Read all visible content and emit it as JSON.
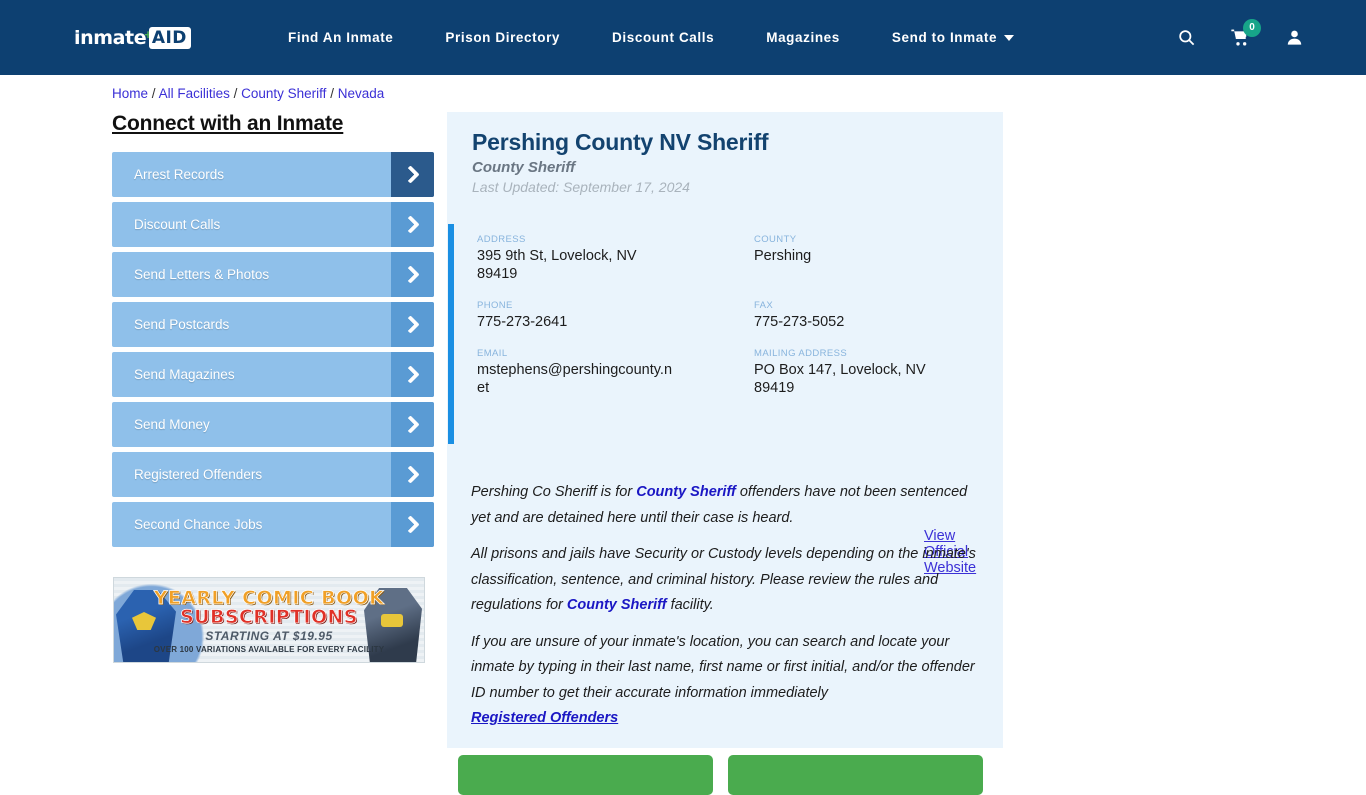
{
  "header": {
    "logo": {
      "part1": "inmate",
      "plus": "+",
      "part2": "AID"
    },
    "nav": [
      {
        "label": "Find An Inmate",
        "has_caret": false
      },
      {
        "label": "Prison Directory",
        "has_caret": false
      },
      {
        "label": "Discount Calls",
        "has_caret": false
      },
      {
        "label": "Magazines",
        "has_caret": false
      },
      {
        "label": "Send to Inmate",
        "has_caret": true
      }
    ],
    "icons": {
      "search": "search-icon",
      "cart": "cart-icon",
      "cart_count": "0",
      "account": "user-icon"
    },
    "background_color": "#0d4071",
    "badge_color": "#17a589"
  },
  "breadcrumb": {
    "items": [
      "Home",
      "All Facilities",
      "County Sheriff",
      "Nevada"
    ],
    "separator": "/",
    "link_color": "#3b30d6"
  },
  "sidebar": {
    "title": "Connect with an Inmate",
    "items": [
      {
        "label": "Arrest Records",
        "active": true
      },
      {
        "label": "Discount Calls",
        "active": false
      },
      {
        "label": "Send Letters & Photos",
        "active": false
      },
      {
        "label": "Send Postcards",
        "active": false
      },
      {
        "label": "Send Magazines",
        "active": false
      },
      {
        "label": "Send Money",
        "active": false
      },
      {
        "label": "Registered Offenders",
        "active": false
      },
      {
        "label": "Second Chance Jobs",
        "active": false
      }
    ],
    "button_color": "#8fc0ea",
    "chevron_color": "#5a9bd4",
    "chevron_active_color": "#2b5a8c"
  },
  "ad": {
    "line1": "YEARLY COMIC BOOK",
    "line2": "SUBSCRIPTIONS",
    "line3": "STARTING AT $19.95",
    "line4": "OVER 100 VARIATIONS AVAILABLE FOR EVERY FACILITY"
  },
  "facility": {
    "title": "Pershing County NV Sheriff",
    "subtitle": "County Sheriff",
    "last_updated": "Last Updated: September 17, 2024",
    "fields": [
      {
        "label": "ADDRESS",
        "value": "395 9th St, Lovelock, NV 89419"
      },
      {
        "label": "COUNTY",
        "value": "Pershing"
      },
      {
        "label": "PHONE",
        "value": "775-273-2641"
      },
      {
        "label": "FAX",
        "value": "775-273-5052"
      },
      {
        "label": "EMAIL",
        "value": "mstephens@pershingcounty.net"
      },
      {
        "label": "MAILING ADDRESS",
        "value": "PO Box 147, Lovelock, NV 89419"
      }
    ],
    "official_website_link": "View Official Website",
    "accent_color": "#1a8fe3",
    "card_background": "#eaf4fc"
  },
  "body": {
    "para1_a": "Pershing Co Sheriff is for ",
    "para1_link": "County Sheriff",
    "para1_b": " offenders have not been sentenced yet and are detained here until their case is heard.",
    "para2_a": "All prisons and jails have Security or Custody levels depending on the inmate's classification, sentence, and criminal history. Please review the rules and regulations for ",
    "para2_link": "County Sheriff",
    "para2_b": " facility.",
    "para3": "If you are unsure of your inmate's location, you can search and locate your inmate by typing in their last name, first name or first initial, and/or the offender ID number to get their accurate information immediately",
    "registered_offenders_link": "Registered Offenders"
  },
  "actions": {
    "button_color": "#4aab4e",
    "buttons": [
      {
        "label": ""
      },
      {
        "label": ""
      }
    ]
  }
}
